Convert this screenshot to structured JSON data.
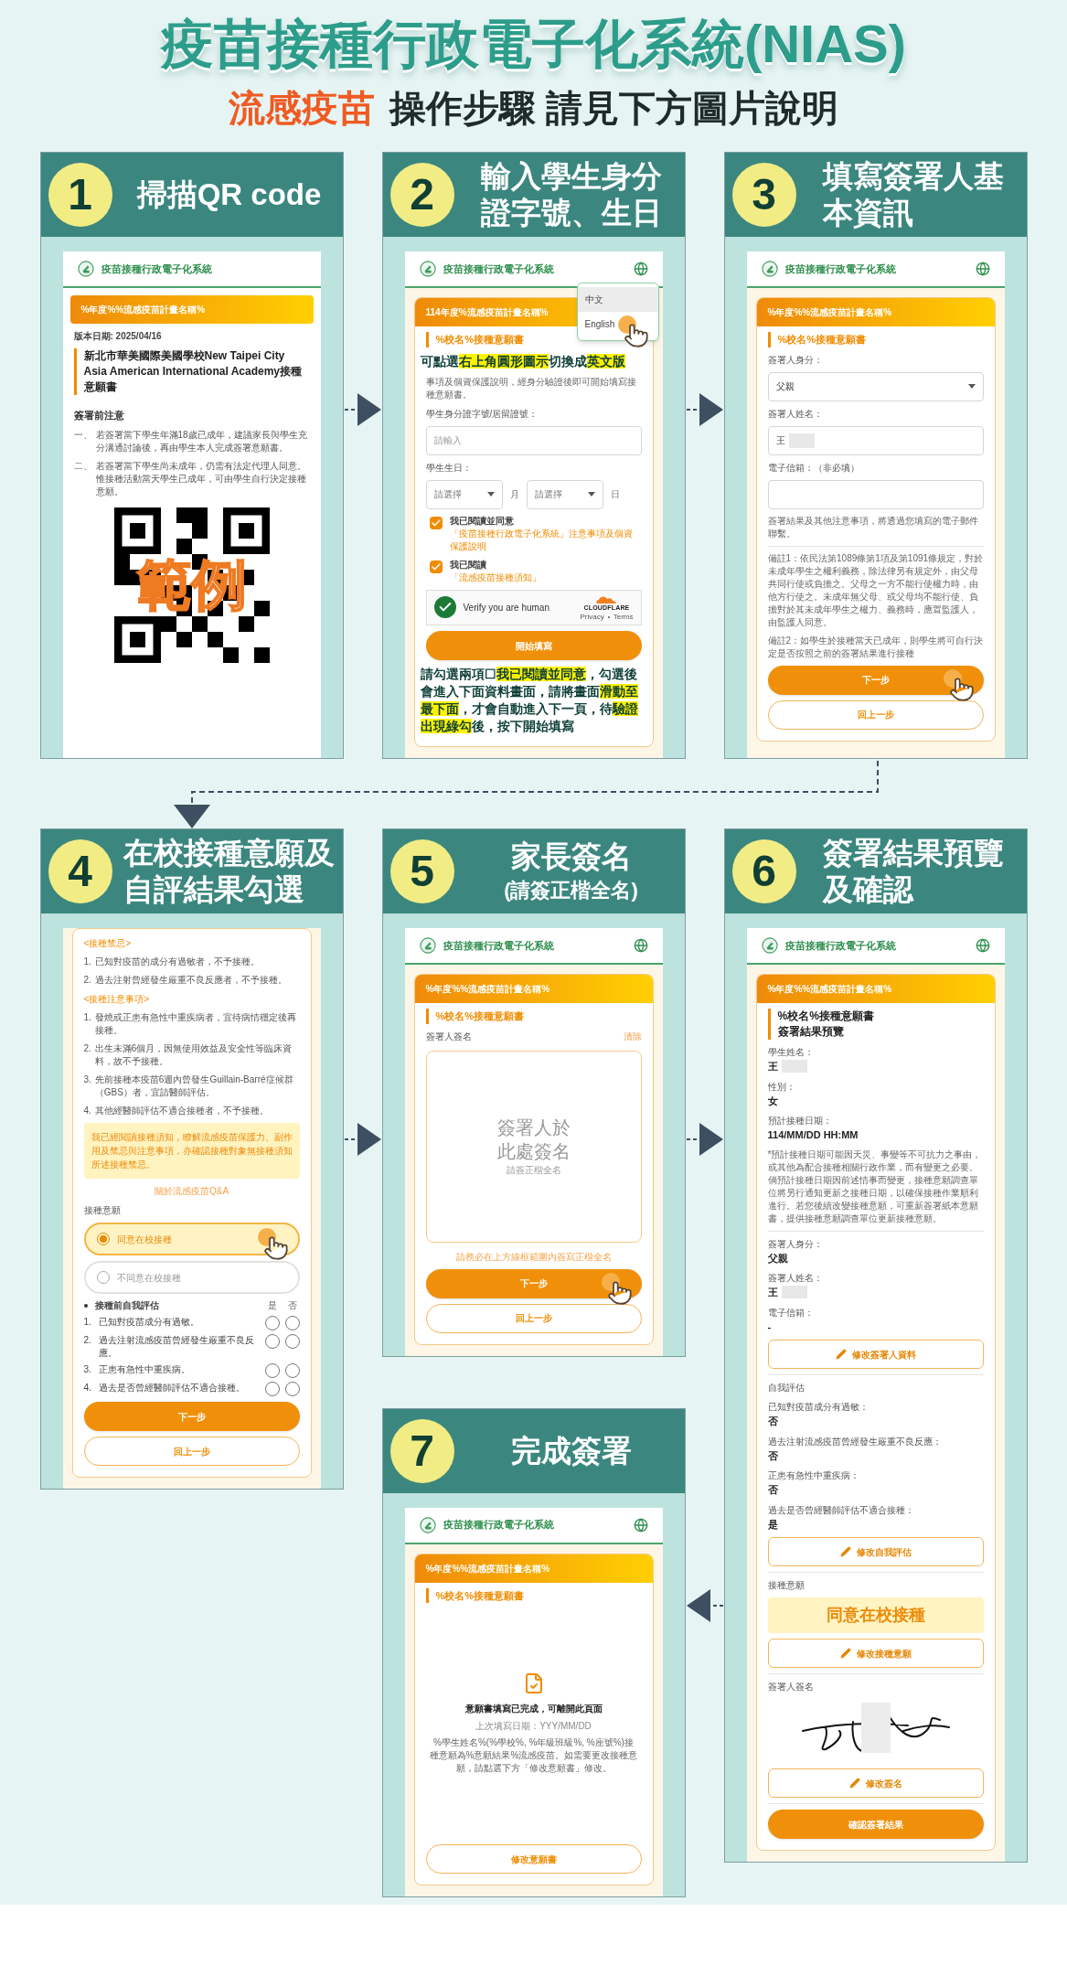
{
  "title": "疫苗接種行政電子化系統(NIAS)",
  "subtitle": {
    "highlight": "流感疫苗",
    "text": "操作步驟 請見下方圖片說明"
  },
  "steps": [
    {
      "number": "1",
      "title": [
        "掃描QR code"
      ],
      "screen": {
        "kind": "page",
        "header": {
          "app_name": "疫苗接種行政電子化系統"
        },
        "blocks": [
          {
            "kind": "banner",
            "text": "%年度%%流感疫苗計畫名稱%"
          },
          {
            "kind": "version",
            "text": "版本日期: 2025/04/16"
          },
          {
            "kind": "doc_title",
            "lines": [
              "新北市華美國際美國學校New Taipei City Asia American International Academy接種意願書"
            ]
          },
          {
            "kind": "heading",
            "text": "簽署前注意"
          },
          {
            "kind": "numbered",
            "marker": "一、",
            "text": "若簽署當下學生年滿18歲已成年，建議家長與學生充分溝通討論後，再由學生本人完成簽署意願書。"
          },
          {
            "kind": "numbered",
            "marker": "二、",
            "text": "若簽署當下學生尚未成年，仍需有法定代理人同意。惟接種活動當天學生已成年，可由學生自行決定接種意願。"
          },
          {
            "kind": "qr",
            "overlay": "範例"
          }
        ]
      }
    },
    {
      "number": "2",
      "title": [
        "輸入學生身分",
        "證字號、生日"
      ],
      "screen": {
        "kind": "form",
        "header": {
          "app_name": "疫苗接種行政電子化系統",
          "language_icon": true,
          "menu": [
            {
              "label": "中文",
              "selected": true
            },
            {
              "label": "English",
              "selected": false,
              "pointer": true
            }
          ]
        },
        "blocks": [
          {
            "kind": "banner",
            "text": "114年度%流感疫苗計畫名稱%"
          },
          {
            "kind": "section",
            "text": "%校名%接種意願書"
          },
          {
            "kind": "callout",
            "segments": [
              {
                "text": "可點選",
                "highlight": false
              },
              {
                "text": "右上角圓形圖示",
                "highlight": true
              },
              {
                "text": "切換成",
                "highlight": false
              },
              {
                "text": "英文版",
                "highlight": true
              }
            ]
          },
          {
            "kind": "paragraph",
            "text": "事項及個資保護說明，經身分驗證後即可開始填寫接種意願書。"
          },
          {
            "kind": "label",
            "text": "學生身分證字號/居留證號："
          },
          {
            "kind": "input",
            "placeholder": "請輸入"
          },
          {
            "kind": "label",
            "text": "學生生日："
          },
          {
            "kind": "date_selects",
            "items": [
              {
                "placeholder": "請選擇",
                "unit": "月"
              },
              {
                "placeholder": "請選擇",
                "unit": "日"
              }
            ]
          },
          {
            "kind": "checkbox",
            "text": "我已閱讀並同意",
            "link": "「疫苗接種行政電子化系統」注意事項及個資保護說明",
            "checked": true
          },
          {
            "kind": "checkbox",
            "text": "我已閱讀",
            "link": "「流感疫苗接種須知」",
            "checked": true
          },
          {
            "kind": "captcha",
            "text": "Verify you are human",
            "verified": true,
            "brand": "CLOUDFLARE",
            "links": [
              "Privacy",
              "Terms"
            ]
          },
          {
            "kind": "primary",
            "text": "開始填寫"
          },
          {
            "kind": "callout",
            "segments": [
              {
                "text": "請勾選兩項☐",
                "highlight": false
              },
              {
                "text": "我已閱讀並同意",
                "highlight": true
              },
              {
                "text": "，勾選後會進入下面資料畫面，請將畫面",
                "highlight": false
              },
              {
                "text": "滑動至最下面",
                "highlight": true
              },
              {
                "text": "，才會自動進入下一頁，待",
                "highlight": false
              },
              {
                "text": "驗證出現綠勾",
                "highlight": true
              },
              {
                "text": "後，按下開始填寫",
                "highlight": false
              }
            ]
          }
        ]
      }
    },
    {
      "number": "3",
      "title": [
        "填寫簽署人基",
        "本資訊"
      ],
      "screen": {
        "kind": "form",
        "header": {
          "app_name": "疫苗接種行政電子化系統",
          "language_icon": true
        },
        "blocks": [
          {
            "kind": "banner",
            "text": "%年度%%流感疫苗計畫名稱%"
          },
          {
            "kind": "section",
            "text": "%校名%接種意願書"
          },
          {
            "kind": "label",
            "text": "簽署人身分："
          },
          {
            "kind": "select",
            "value": "父親"
          },
          {
            "kind": "label",
            "text": "簽署人姓名："
          },
          {
            "kind": "input",
            "value": "王",
            "redacted": true
          },
          {
            "kind": "label",
            "text": "電子信箱：（非必填）"
          },
          {
            "kind": "input"
          },
          {
            "kind": "paragraph",
            "text": "簽署結果及其他注意事項，將透過您填寫的電子郵件聯繫。"
          },
          {
            "kind": "divider"
          },
          {
            "kind": "paragraph",
            "text": "備註1：依民法第1089條第1項及第1091條規定，對於未成年學生之權利義務，除法律另有規定外，由父母共同行使或負擔之。父母之一方不能行使權力時，由他方行使之。未成年無父母、或父母均不能行使、負擔對於其未成年學生之權力、義務時，應置監護人，由監護人同意。"
          },
          {
            "kind": "paragraph",
            "text": "備註2：如學生於接種當天已成年，則學生將可自行決定是否按照之前的簽署結果進行接種"
          },
          {
            "kind": "primary",
            "text": "下一步",
            "pointer": true
          },
          {
            "kind": "outline",
            "text": "回上一步"
          }
        ]
      }
    },
    {
      "number": "4",
      "title": [
        "在校接種意願及",
        "自評結果勾選"
      ],
      "screen": {
        "kind": "form",
        "blocks": [
          {
            "kind": "orange_heading",
            "text": "<接種禁忌>"
          },
          {
            "kind": "numbered",
            "marker": "1.",
            "text": "已知對疫苗的成分有過敏者，不予接種。"
          },
          {
            "kind": "numbered",
            "marker": "2.",
            "text": "過去注射曾經發生嚴重不良反應者，不予接種。"
          },
          {
            "kind": "orange_heading",
            "text": "<接種注意事項>"
          },
          {
            "kind": "numbered",
            "marker": "1.",
            "text": "發燒或正患有急性中重疾病者，宜待病情穩定後再接種。"
          },
          {
            "kind": "numbered",
            "marker": "2.",
            "text": "出生未滿6個月，因無使用效益及安全性等臨床資料，故不予接種。"
          },
          {
            "kind": "numbered",
            "marker": "3.",
            "text": "先前接種本疫苗6週內曾發生Guillain-Barré症候群（GBS）者，宜請醫師評估。"
          },
          {
            "kind": "numbered",
            "marker": "4.",
            "text": "其他經醫師評估不適合接種者，不予接種。"
          },
          {
            "kind": "notice",
            "text": "我已經閱讀接種須知，瞭解流感疫苗保護力、副作用及禁忌與注意事項，亦確認接種對象無接種須知所述接種禁忌。"
          },
          {
            "kind": "link",
            "text": "關於流感疫苗Q&A"
          },
          {
            "kind": "label",
            "text": "接種意願"
          },
          {
            "kind": "radio_option",
            "label": "同意在校接種",
            "selected": true,
            "pointer": true
          },
          {
            "kind": "radio_option",
            "label": "不同意在校接種",
            "selected": false
          },
          {
            "kind": "assessment",
            "heading": "接種前自我評估",
            "columns": [
              "是",
              "否"
            ],
            "items": [
              {
                "marker": "1.",
                "text": "已知對疫苗成分有過敏。"
              },
              {
                "marker": "2.",
                "text": "過去注射流感疫苗曾經發生嚴重不良反應。"
              },
              {
                "marker": "3.",
                "text": "正患有急性中重疾病。"
              },
              {
                "marker": "4.",
                "text": "過去是否曾經醫師評估不適合接種。"
              }
            ]
          },
          {
            "kind": "primary",
            "text": "下一步"
          },
          {
            "kind": "outline",
            "text": "回上一步"
          }
        ]
      }
    },
    {
      "number": "5",
      "title": [
        "家長簽名"
      ],
      "subtitle": "(請簽正楷全名)",
      "screen": {
        "kind": "form",
        "header": {
          "app_name": "疫苗接種行政電子化系統",
          "language_icon": true
        },
        "blocks": [
          {
            "kind": "banner",
            "text": "%年度%%流感疫苗計畫名稱%"
          },
          {
            "kind": "section",
            "text": "%校名%接種意願書"
          },
          {
            "kind": "signature_pad",
            "label": "簽署人簽名",
            "action": "清除",
            "placeholder": [
              "簽署人於",
              "此處簽名"
            ],
            "sub": "請簽正楷全名",
            "hint": "請務必在上方線框範圍內簽寫正楷全名"
          },
          {
            "kind": "primary",
            "text": "下一步",
            "pointer": true
          },
          {
            "kind": "outline",
            "text": "回上一步"
          }
        ]
      }
    },
    {
      "number": "6",
      "title": [
        "簽署結果預覽",
        "及確認"
      ],
      "screen": {
        "kind": "form",
        "header": {
          "app_name": "疫苗接種行政電子化系統",
          "language_icon": true
        },
        "blocks": [
          {
            "kind": "banner",
            "text": "%年度%%流感疫苗計畫名稱%"
          },
          {
            "kind": "doc_title",
            "lines": [
              "%校名%接種意願書",
              "簽署結果預覽"
            ]
          },
          {
            "kind": "field_value",
            "label": "學生姓名：",
            "value": "王",
            "redacted": true
          },
          {
            "kind": "field_value",
            "label": "性別：",
            "value": "女"
          },
          {
            "kind": "field_value",
            "label": "預計接種日期：",
            "value": "114/MM/DD HH:MM"
          },
          {
            "kind": "paragraph",
            "text": "*預計接種日期可能因天災、事變等不可抗力之事由，或其他為配合接種相關行政作業，而有變更之必要。倘預計接種日期因前述情事而變更，接種意願調查單位將另行通知更新之接種日期，以確保接種作業順利進行。若您後續改變接種意願，可重新簽署紙本意願書，提供接種意願調查單位更新接種意願。"
          },
          {
            "kind": "divider"
          },
          {
            "kind": "field_value",
            "label": "簽署人身分：",
            "value": "父親"
          },
          {
            "kind": "field_value",
            "label": "簽署人姓名：",
            "value": "王",
            "redacted": true
          },
          {
            "kind": "field_value",
            "label": "電子信箱：",
            "value": "-"
          },
          {
            "kind": "edit",
            "text": "修改簽署人資料"
          },
          {
            "kind": "divider"
          },
          {
            "kind": "label",
            "text": "自我評估"
          },
          {
            "kind": "field_value",
            "label": "已知對疫苗成分有過敏：",
            "value": "否"
          },
          {
            "kind": "field_value",
            "label": "過去注射流感疫苗曾經發生嚴重不良反應：",
            "value": "否"
          },
          {
            "kind": "field_value",
            "label": "正患有急性中重疾病：",
            "value": "否"
          },
          {
            "kind": "field_value",
            "label": "過去是否曾經醫師評估不適合接種：",
            "value": "是"
          },
          {
            "kind": "edit",
            "text": "修改自我評估"
          },
          {
            "kind": "divider"
          },
          {
            "kind": "label",
            "text": "接種意願"
          },
          {
            "kind": "big_value",
            "text": "同意在校接種"
          },
          {
            "kind": "edit",
            "text": "修改接種意願"
          },
          {
            "kind": "divider"
          },
          {
            "kind": "label",
            "text": "簽署人簽名"
          },
          {
            "kind": "signature",
            "redacted": true
          },
          {
            "kind": "edit",
            "text": "修改簽名"
          },
          {
            "kind": "divider"
          },
          {
            "kind": "primary",
            "text": "確認簽署結果"
          }
        ]
      }
    },
    {
      "number": "7",
      "title": [
        "完成簽署"
      ],
      "screen": {
        "kind": "form",
        "header": {
          "app_name": "疫苗接種行政電子化系統",
          "language_icon": true
        },
        "blocks": [
          {
            "kind": "banner",
            "text": "%年度%%流感疫苗計畫名稱%"
          },
          {
            "kind": "section",
            "text": "%校名%接種意願書"
          },
          {
            "kind": "completion",
            "title": "意願書填寫已完成，可離開此頁面",
            "date": "上次填寫日期：YYY/MM/DD",
            "message": "%學生姓名%(%學校%, %年級班級%, %座號%)接種意願為%意願結果%流感疫苗。如需要更改接種意願，請點選下方「修改意願書」修改。"
          },
          {
            "kind": "outline",
            "text": "修改意願書"
          }
        ]
      }
    }
  ]
}
